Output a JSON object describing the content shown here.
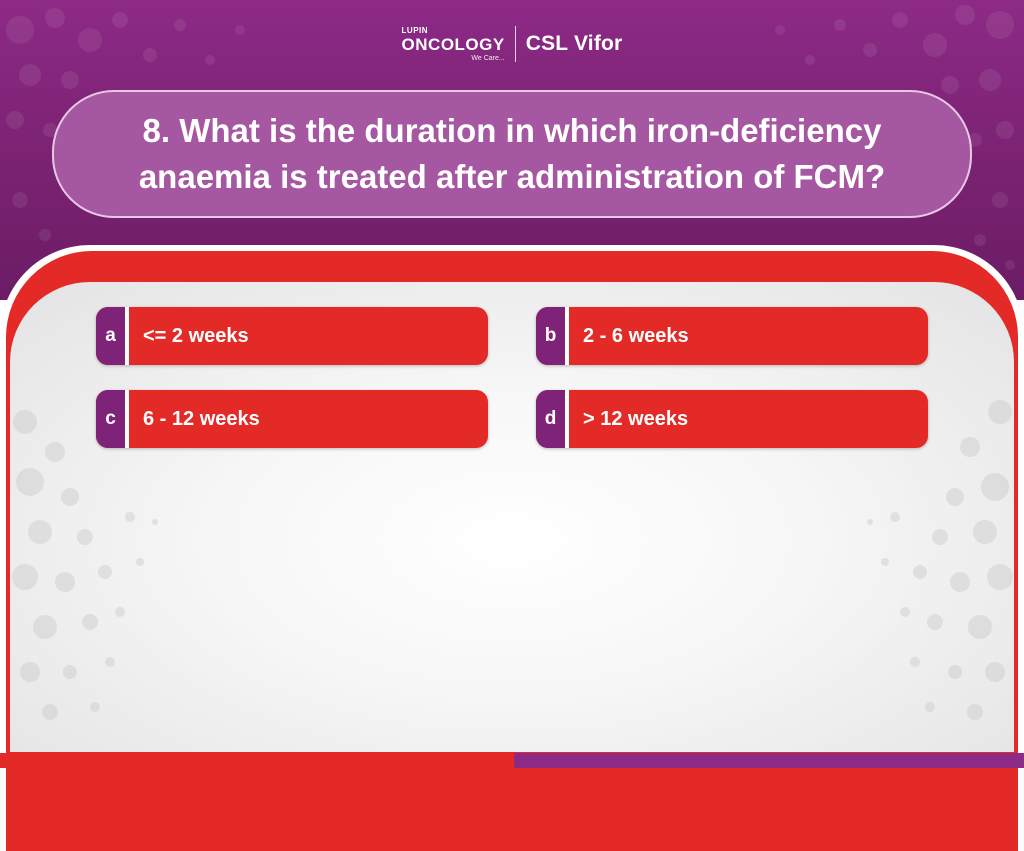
{
  "header": {
    "lupin_small": "LUPIN",
    "lupin_main": "ONCOLOGY",
    "lupin_tagline": "We Care...",
    "partner": "CSL Vifor"
  },
  "question": {
    "line1": "8. What is the duration in which iron-deficiency",
    "line2": "anaemia is treated after administration of FCM?"
  },
  "options": [
    {
      "letter": "a",
      "text": "<= 2 weeks"
    },
    {
      "letter": "b",
      "text": "2 - 6 weeks"
    },
    {
      "letter": "c",
      "text": "6 - 12 weeks"
    },
    {
      "letter": "d",
      "text": "> 12 weeks"
    }
  ],
  "colors": {
    "brand_purple": "#8d2a86",
    "accent_red": "#e32a27",
    "letter_tab": "#7f2379"
  }
}
